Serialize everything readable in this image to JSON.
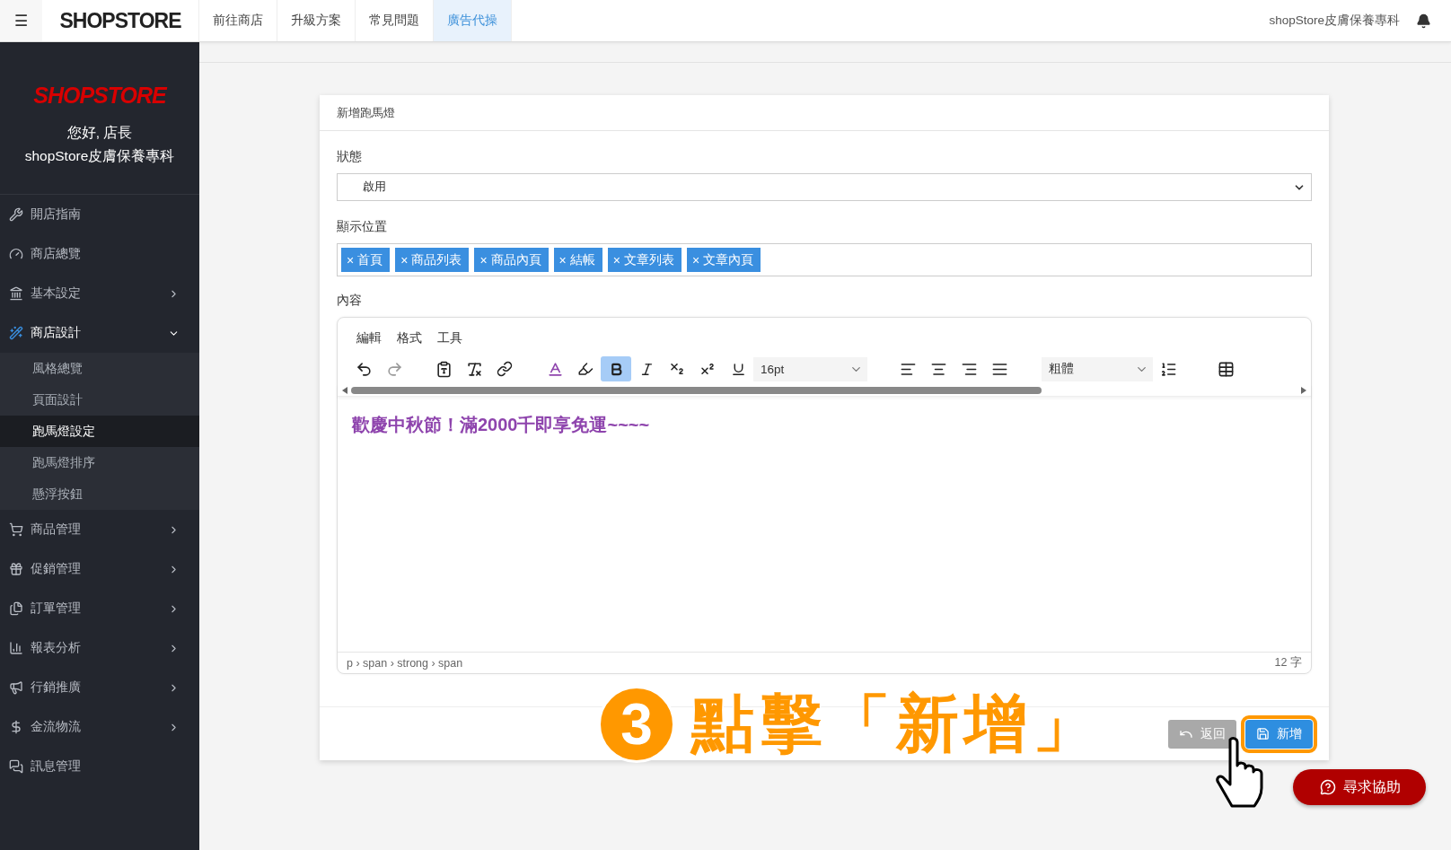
{
  "topbar": {
    "toggle": "☰",
    "logo": "SHOPSTORE",
    "tabs": [
      {
        "label": "前往商店",
        "selected": false
      },
      {
        "label": "升級方案",
        "selected": false
      },
      {
        "label": "常見問題",
        "selected": false
      },
      {
        "label": "廣告代操",
        "selected": true
      }
    ],
    "store_name": "shopStore皮膚保養專科"
  },
  "sidebar": {
    "logo": "SHOPSTORE",
    "greeting": "您好, 店長",
    "store_name": "shopStore皮膚保養專科",
    "items": [
      {
        "label": "開店指南",
        "has_arrow": false,
        "expanded": false
      },
      {
        "label": "商店總覽",
        "has_arrow": false,
        "expanded": false
      },
      {
        "label": "基本設定",
        "has_arrow": true,
        "expanded": false
      },
      {
        "label": "商店設計",
        "has_arrow": true,
        "expanded": true,
        "children": [
          {
            "label": "風格總覽",
            "selected": false
          },
          {
            "label": "頁面設計",
            "selected": false
          },
          {
            "label": "跑馬燈設定",
            "selected": true
          },
          {
            "label": "跑馬燈排序",
            "selected": false
          },
          {
            "label": "懸浮按鈕",
            "selected": false
          }
        ]
      },
      {
        "label": "商品管理",
        "has_arrow": true,
        "expanded": false
      },
      {
        "label": "促銷管理",
        "has_arrow": true,
        "expanded": false
      },
      {
        "label": "訂單管理",
        "has_arrow": true,
        "expanded": false
      },
      {
        "label": "報表分析",
        "has_arrow": true,
        "expanded": false
      },
      {
        "label": "行銷推廣",
        "has_arrow": true,
        "expanded": false
      },
      {
        "label": "金流物流",
        "has_arrow": true,
        "expanded": false
      },
      {
        "label": "訊息管理",
        "has_arrow": false,
        "expanded": false
      }
    ]
  },
  "card": {
    "title": "新增跑馬燈",
    "status_label": "狀態",
    "status_value": "啟用",
    "location_label": "顯示位置",
    "tags": [
      "首頁",
      "商品列表",
      "商品內頁",
      "結帳",
      "文章列表",
      "文章內頁"
    ],
    "tag_remove": "×",
    "content_label": "內容",
    "editor": {
      "menu": [
        "編輯",
        "格式",
        "工具"
      ],
      "bold_on": true,
      "font_size": "16pt",
      "font_style": "粗體",
      "content": "歡慶中秋節！滿2000千即享免運~~~~",
      "path": "p › span › strong › span",
      "word_count": "12 字"
    },
    "buttons": [
      {
        "label": "返回",
        "disabled": true,
        "highlighted": false
      },
      {
        "label": "新增",
        "disabled": false,
        "highlighted": true
      }
    ]
  },
  "annotation": {
    "step": "3",
    "text": "點擊「新增」"
  },
  "help_button": "尋求協助"
}
